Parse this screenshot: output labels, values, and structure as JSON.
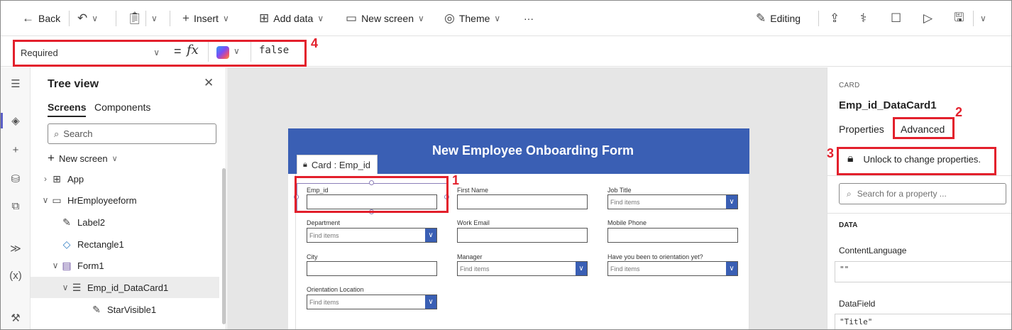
{
  "toolbar": {
    "back": "Back",
    "insert": "Insert",
    "add_data": "Add data",
    "new_screen": "New screen",
    "theme": "Theme",
    "more": "···",
    "editing": "Editing"
  },
  "formula_bar": {
    "property": "Required",
    "equals": "=",
    "fx": "fx",
    "formula": "false",
    "annotation": "4"
  },
  "tree_view": {
    "title": "Tree view",
    "tabs": [
      "Screens",
      "Components"
    ],
    "search_placeholder": "Search",
    "new_screen": "New screen",
    "items": [
      {
        "label": "App",
        "icon": "app-icon"
      },
      {
        "label": "HrEmployeeform",
        "icon": "screen-icon"
      },
      {
        "label": "Label2",
        "icon": "label-icon"
      },
      {
        "label": "Rectangle1",
        "icon": "shape-icon"
      },
      {
        "label": "Form1",
        "icon": "form-icon"
      },
      {
        "label": "Emp_id_DataCard1",
        "icon": "card-icon"
      },
      {
        "label": "StarVisible1",
        "icon": "label-icon"
      }
    ]
  },
  "canvas": {
    "header_title": "New Employee Onboarding Form",
    "card_tab": "Card : Emp_id",
    "annotation": "1",
    "fields": {
      "emp_id": "Emp_id",
      "first_name": "First Name",
      "job_title": "Job Title",
      "department": "Department",
      "work_email": "Work Email",
      "mobile_phone": "Mobile Phone",
      "city": "City",
      "manager": "Manager",
      "orientation": "Have you been to orientation yet?",
      "orientation_location": "Orientation Location"
    },
    "dropdown_placeholder": "Find items"
  },
  "properties": {
    "kind": "CARD",
    "name": "Emp_id_DataCard1",
    "tabs": [
      "Properties",
      "Advanced"
    ],
    "unlock_text": "Unlock to change properties.",
    "search_placeholder": "Search for a property ...",
    "section": "DATA",
    "content_language_label": "ContentLanguage",
    "content_language_value": "\"\"",
    "datafield_label": "DataField",
    "datafield_value": "\"Title\"",
    "annotation_advanced": "2",
    "annotation_unlock": "3"
  },
  "colors": {
    "accent_red": "#e3202c",
    "header_blue": "#3a5fb4"
  }
}
